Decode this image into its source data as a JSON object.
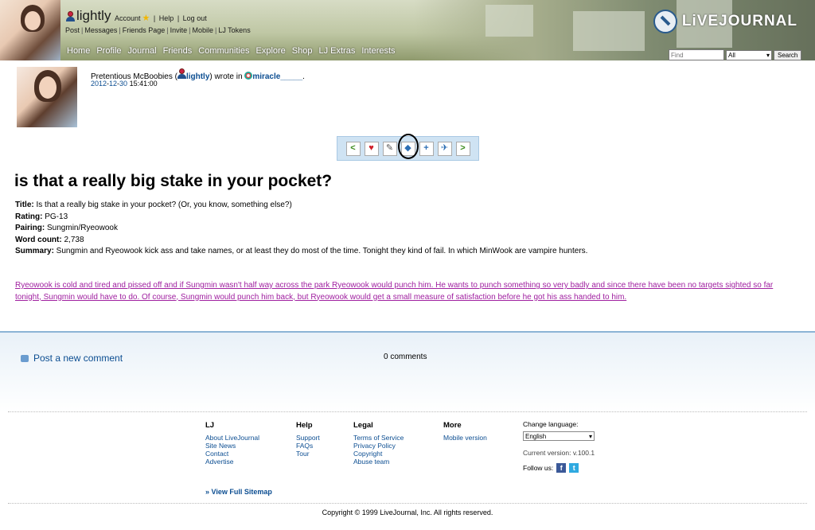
{
  "header": {
    "username": "lightly",
    "account_label": "Account",
    "help_label": "Help",
    "logout_label": "Log out",
    "subnav": [
      "Post",
      "Messages",
      "Friends Page",
      "Invite",
      "Mobile",
      "LJ Tokens"
    ],
    "mainnav": [
      "Home",
      "Profile",
      "Journal",
      "Friends",
      "Communities",
      "Explore",
      "Shop",
      "LJ Extras",
      "Interests"
    ],
    "logo_text": "LiVEJOURNAL",
    "search": {
      "placeholder": "Find",
      "scope": "All",
      "button": "Search"
    }
  },
  "entry": {
    "poster_name": "Pretentious McBoobies",
    "poster_username": "lightly",
    "wrote_in": "wrote in",
    "community": "miracle_____",
    "date_year": "2012",
    "date_month": "12",
    "date_day": "30",
    "time": "15:41:00"
  },
  "toolbar": {
    "icons": [
      "prev-arrow-icon",
      "heart-icon",
      "pencil-icon",
      "tag-icon",
      "plus-icon",
      "pin-icon",
      "next-arrow-icon"
    ]
  },
  "post": {
    "title": "is that a really big stake in your pocket?",
    "meta": [
      {
        "label": "Title:",
        "value": " Is that a really big stake in your pocket? (Or, you know, something else?)"
      },
      {
        "label": "Rating:",
        "value": " PG-13"
      },
      {
        "label": "Pairing:",
        "value": " Sungmin/Ryeowook"
      },
      {
        "label": "Word count:",
        "value": " 2,738"
      },
      {
        "label": "Summary:",
        "value": " Sungmin and Ryeowook kick ass and take names, or at least they do most of the time. Tonight they kind of fail. In which MinWook are vampire hunters."
      }
    ],
    "body_link": "Ryeowook is cold and tired and pissed off and if Sungmin wasn't half way across the park Ryeowook would punch him. He wants to punch something so very badly and since there have been no targets sighted so far tonight, Sungmin would have to do. Of course, Sungmin would punch him back, but Ryeowook would get a small measure of satisfaction before he got his ass handed to him."
  },
  "comments": {
    "post_label": "Post a new comment",
    "count_label": "0 comments"
  },
  "footer": {
    "columns": [
      {
        "title": "LJ",
        "links": [
          "About LiveJournal",
          "Site News",
          "Contact",
          "Advertise"
        ]
      },
      {
        "title": "Help",
        "links": [
          "Support",
          "FAQs",
          "Tour"
        ]
      },
      {
        "title": "Legal",
        "links": [
          "Terms of Service",
          "Privacy Policy",
          "Copyright",
          "Abuse team"
        ]
      },
      {
        "title": "More",
        "links": [
          "Mobile version"
        ]
      }
    ],
    "change_language": "Change language:",
    "language": "English",
    "version_label": "Current version:",
    "version": "v.100.1",
    "follow_label": "Follow us:",
    "sitemap": "» View Full Sitemap",
    "copyright": "Copyright © 1999 LiveJournal, Inc. All rights reserved."
  }
}
